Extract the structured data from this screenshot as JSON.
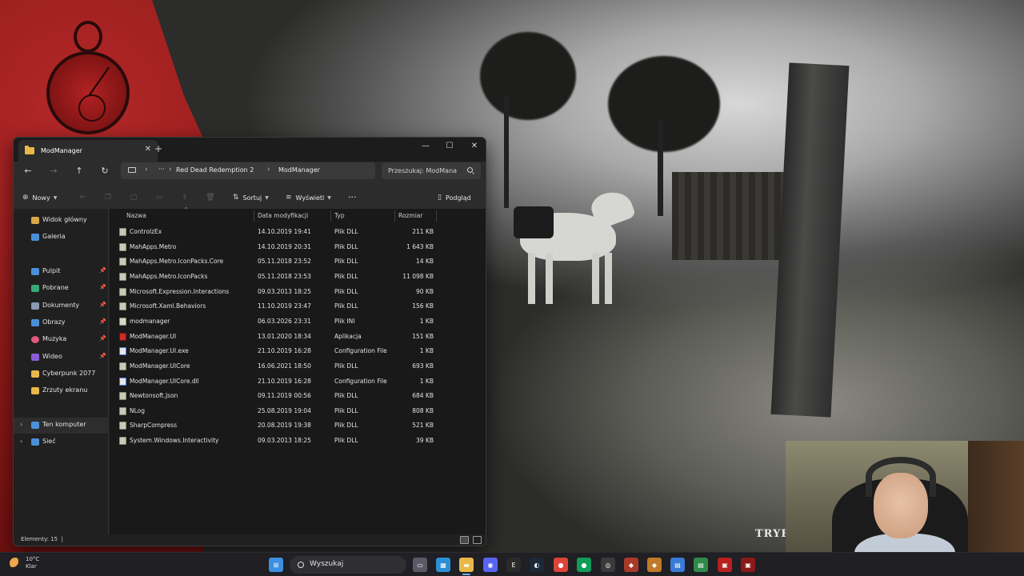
{
  "window": {
    "tab_title": "ModManager",
    "new_tab": "+",
    "controls": {
      "minimize": "—",
      "maximize": "☐",
      "close": "✕"
    }
  },
  "nav": {
    "back": "←",
    "forward": "→",
    "up": "↑",
    "refresh": "↻",
    "breadcrumb": [
      "Red Dead Redemption 2",
      "ModManager"
    ],
    "more": "···",
    "search_placeholder": "Przeszukaj: ModMana"
  },
  "toolbar": {
    "new_label": "Nowy",
    "sort_label": "Sortuj",
    "view_label": "Wyświetl",
    "more": "···",
    "preview_label": "Podgląd"
  },
  "sidebar": {
    "quick": [
      {
        "label": "Widok główny",
        "icon": "home-icon",
        "color": "#d9a84a"
      },
      {
        "label": "Galeria",
        "icon": "gallery-icon",
        "color": "#4a90d8"
      }
    ],
    "pinned": [
      {
        "label": "Pulpit",
        "icon": "desktop-icon",
        "color": "#4a90d8"
      },
      {
        "label": "Pobrane",
        "icon": "download-icon",
        "color": "#3aa87a"
      },
      {
        "label": "Dokumenty",
        "icon": "documents-icon",
        "color": "#8a9ab0"
      },
      {
        "label": "Obrazy",
        "icon": "pictures-icon",
        "color": "#4a90d8"
      },
      {
        "label": "Muzyka",
        "icon": "music-icon",
        "color": "#e05a7a"
      },
      {
        "label": "Wideo",
        "icon": "video-icon",
        "color": "#8a5ad8"
      },
      {
        "label": "Cyberpunk 2077",
        "icon": "folder-icon",
        "color": "#e8b84a"
      },
      {
        "label": "Zrzuty ekranu",
        "icon": "folder-icon",
        "color": "#e8b84a"
      }
    ],
    "devices": [
      {
        "label": "Ten komputer",
        "icon": "computer-icon",
        "color": "#4a90d8"
      },
      {
        "label": "Sieć",
        "icon": "network-icon",
        "color": "#4a90d8"
      }
    ]
  },
  "columns": {
    "name": "Nazwa",
    "modified": "Data modyfikacji",
    "type": "Typ",
    "size": "Rozmiar"
  },
  "files": [
    {
      "name": "ControlzEx",
      "modified": "14.10.2019 19:41",
      "type": "Plik DLL",
      "size": "211 KB",
      "kind": "dll"
    },
    {
      "name": "MahApps.Metro",
      "modified": "14.10.2019 20:31",
      "type": "Plik DLL",
      "size": "1 643 KB",
      "kind": "dll"
    },
    {
      "name": "MahApps.Metro.IconPacks.Core",
      "modified": "05.11.2018 23:52",
      "type": "Plik DLL",
      "size": "14 KB",
      "kind": "dll"
    },
    {
      "name": "MahApps.Metro.IconPacks",
      "modified": "05.11.2018 23:53",
      "type": "Plik DLL",
      "size": "11 098 KB",
      "kind": "dll"
    },
    {
      "name": "Microsoft.Expression.Interactions",
      "modified": "09.03.2013 18:25",
      "type": "Plik DLL",
      "size": "90 KB",
      "kind": "dll"
    },
    {
      "name": "Microsoft.Xaml.Behaviors",
      "modified": "11.10.2019 23:47",
      "type": "Plik DLL",
      "size": "156 KB",
      "kind": "dll"
    },
    {
      "name": "modmanager",
      "modified": "06.03.2026 23:31",
      "type": "Plik INI",
      "size": "1 KB",
      "kind": "ini"
    },
    {
      "name": "ModManager.UI",
      "modified": "13.01.2020 18:34",
      "type": "Aplikacja",
      "size": "151 KB",
      "kind": "app"
    },
    {
      "name": "ModManager.UI.exe",
      "modified": "21.10.2019 16:28",
      "type": "Configuration File",
      "size": "1 KB",
      "kind": "cfg"
    },
    {
      "name": "ModManager.UICore",
      "modified": "16.06.2021 18:50",
      "type": "Plik DLL",
      "size": "693 KB",
      "kind": "dll"
    },
    {
      "name": "ModManager.UICore.dll",
      "modified": "21.10.2019 16:28",
      "type": "Configuration File",
      "size": "1 KB",
      "kind": "cfg"
    },
    {
      "name": "Newtonsoft.Json",
      "modified": "09.11.2019 00:56",
      "type": "Plik DLL",
      "size": "684 KB",
      "kind": "dll"
    },
    {
      "name": "NLog",
      "modified": "25.08.2019 19:04",
      "type": "Plik DLL",
      "size": "808 KB",
      "kind": "dll"
    },
    {
      "name": "SharpCompress",
      "modified": "20.08.2019 19:38",
      "type": "Plik DLL",
      "size": "521 KB",
      "kind": "dll"
    },
    {
      "name": "System.Windows.Interactivity",
      "modified": "09.03.2013 18:25",
      "type": "Plik DLL",
      "size": "39 KB",
      "kind": "dll"
    }
  ],
  "status": {
    "items": "Elementy: 15",
    "separator": "|"
  },
  "overlay": {
    "stream_text": "TRYB"
  },
  "taskbar": {
    "weather_temp": "10°C",
    "weather_desc": "Klar",
    "search_label": "Wyszukaj",
    "apps": [
      {
        "name": "start-icon",
        "color": "#3d8fe0",
        "glyph": "⊞"
      },
      {
        "name": "task-view-icon",
        "color": "#5a5a66",
        "glyph": "▭"
      },
      {
        "name": "photos-icon",
        "color": "#2b8fd6",
        "glyph": "▦"
      },
      {
        "name": "file-explorer-icon",
        "color": "#e8b84a",
        "glyph": "▬"
      },
      {
        "name": "discord-icon",
        "color": "#5865f2",
        "glyph": "◉"
      },
      {
        "name": "epic-games-icon",
        "color": "#2a2a2a",
        "glyph": "E"
      },
      {
        "name": "steam-icon",
        "color": "#1b2838",
        "glyph": "◐"
      },
      {
        "name": "chrome-icon",
        "color": "#db4437",
        "glyph": "●"
      },
      {
        "name": "chrome-profile-icon",
        "color": "#0f9d58",
        "glyph": "●"
      },
      {
        "name": "obs-icon",
        "color": "#3a3a3a",
        "glyph": "◎"
      },
      {
        "name": "game-app-icon",
        "color": "#a83a2a",
        "glyph": "◆"
      },
      {
        "name": "game-launcher-icon",
        "color": "#c07a2a",
        "glyph": "◆"
      },
      {
        "name": "notepad-icon",
        "color": "#3a7ad8",
        "glyph": "▤"
      },
      {
        "name": "spreadsheet-icon",
        "color": "#2f8a4a",
        "glyph": "▤"
      },
      {
        "name": "mod-app-icon",
        "color": "#b82020",
        "glyph": "▣"
      },
      {
        "name": "rdr2-icon",
        "color": "#8a1a1a",
        "glyph": "▣"
      }
    ]
  }
}
